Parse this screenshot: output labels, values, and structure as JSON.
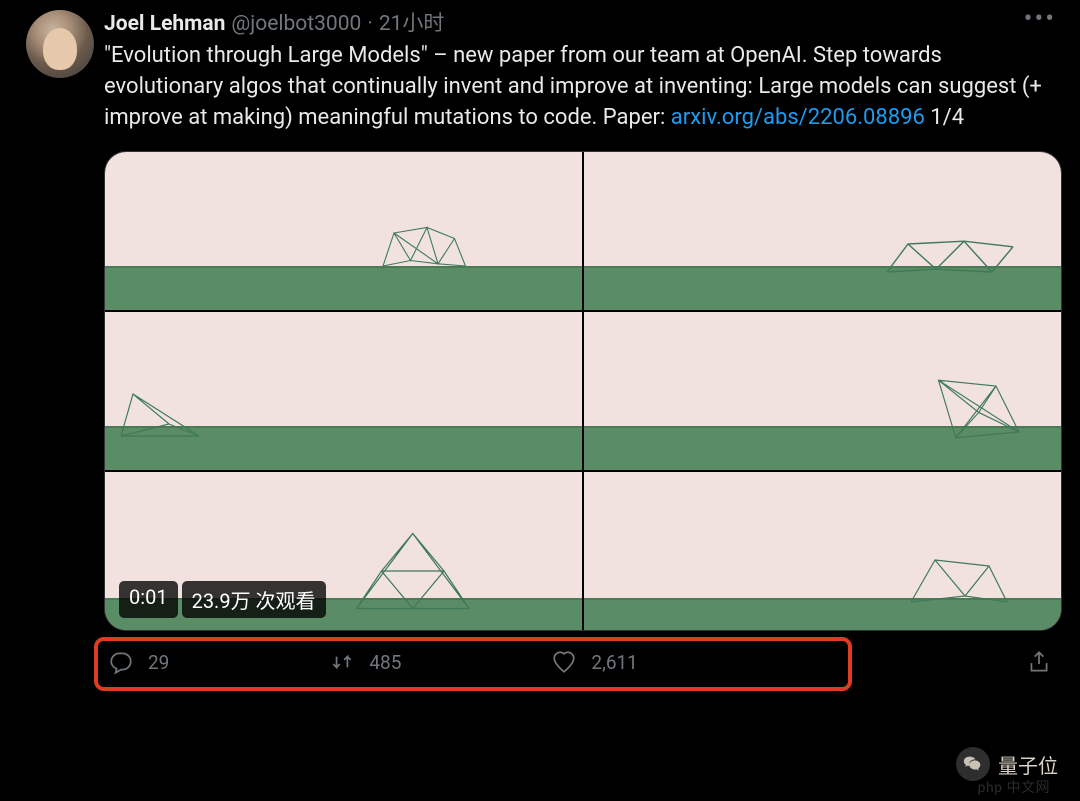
{
  "header": {
    "display_name": "Joel Lehman",
    "handle": "@joelbot3000",
    "separator": "·",
    "time": "21小时"
  },
  "body": {
    "text_before_link": "\"Evolution through Large Models\" – new paper from our team at OpenAI. Step towards evolutionary algos that continually invent and improve at inventing: Large models can suggest (+ improve at making) meaningful mutations to code. Paper: ",
    "link_text": "arxiv.org/abs/2206.08896",
    "text_after_link": " 1/4"
  },
  "video": {
    "time_elapsed": "0:01",
    "views_label": "23.9万 次观看"
  },
  "actions": {
    "reply_count": "29",
    "retweet_count": "485",
    "like_count": "2,611"
  },
  "overlay": {
    "channel": "量子位",
    "watermark": "php 中文网"
  }
}
